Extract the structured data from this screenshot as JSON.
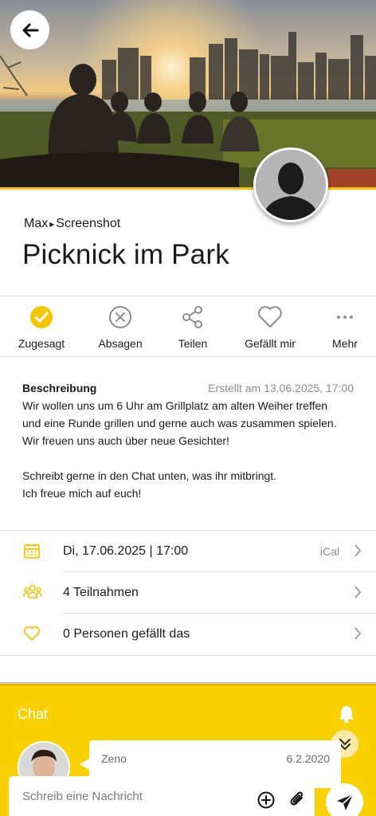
{
  "header": {
    "back_icon": "arrow-left-icon",
    "hero_image": "picnic-park-photo",
    "avatar": "person-silhouette-avatar"
  },
  "event": {
    "breadcrumb_user": "Max",
    "breadcrumb_separator": "▸",
    "breadcrumb_section": "Screenshot",
    "title": "Picknick im Park"
  },
  "actions": [
    {
      "label": "Zugesagt",
      "icon": "check-circle-icon",
      "active": true
    },
    {
      "label": "Absagen",
      "icon": "x-circle-icon"
    },
    {
      "label": "Teilen",
      "icon": "share-icon"
    },
    {
      "label": "Gefällt mir",
      "icon": "heart-icon"
    },
    {
      "label": "Mehr",
      "icon": "more-dots-icon"
    }
  ],
  "description": {
    "heading": "Beschreibung",
    "created": "Erstellt am 13.06.2025, 17:00",
    "lines": [
      "Wir wollen uns um 6 Uhr am Grillplatz am alten Weiher treffen",
      "und eine Runde grillen und gerne auch was zusammen spielen.",
      "Wir freuen uns auch über neue Gesichter!",
      "",
      "Schreibt gerne in den Chat unten, was ihr mitbringt.",
      "Ich freue mich auf euch!"
    ]
  },
  "info": {
    "date": {
      "text": "Di, 17.06.2025 | 17:00",
      "extra": "iCal",
      "icon": "calendar-icon"
    },
    "participants": {
      "text": "4 Teilnahmen",
      "icon": "group-icon"
    },
    "likes": {
      "text": "0 Personen gefällt das",
      "icon": "heart-outline-icon"
    }
  },
  "chat": {
    "title": "Chat",
    "bell_icon": "bell-icon",
    "message": {
      "sender": "Zeno",
      "date": "6.2.2020"
    },
    "composer_placeholder": "Schreib eine Nachricht",
    "send_icon": "send-icon"
  },
  "colors": {
    "accent": "#f9d100",
    "check": "#f5c400",
    "icon_gray": "#8c8c8c",
    "divider": "#dcdcdc"
  }
}
